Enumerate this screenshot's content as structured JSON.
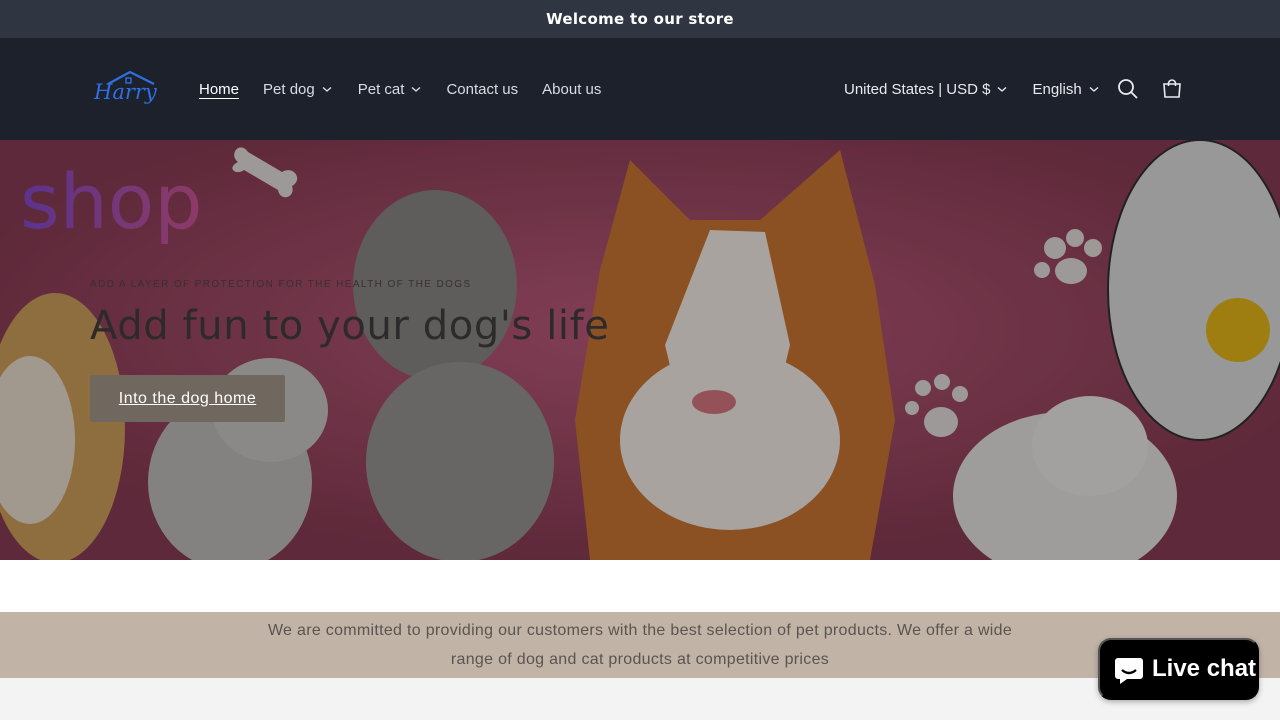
{
  "announcement": "Welcome to our store",
  "logo": {
    "text": "Harry"
  },
  "nav": {
    "items": [
      {
        "label": "Home",
        "active": true
      },
      {
        "label": "Pet dog",
        "has_dropdown": true
      },
      {
        "label": "Pet cat",
        "has_dropdown": true
      },
      {
        "label": "Contact us"
      },
      {
        "label": "About us"
      }
    ]
  },
  "tools": {
    "country_currency": "United States | USD $",
    "language": "English",
    "icons": [
      "search-icon",
      "cart-icon"
    ]
  },
  "hero": {
    "background_text": "shop",
    "kicker": "ADD A LAYER OF PROTECTION FOR THE HEALTH OF THE DOGS",
    "title": "Add fun to your dog's life",
    "button_label": "Into the dog home"
  },
  "commitment": {
    "line1": "We are committed to providing our customers with the best selection of pet products. We offer a wide",
    "line2": "range of dog and cat products at competitive prices"
  },
  "live_chat": {
    "label": "Live chat"
  },
  "colors": {
    "announcement_bg": "#2f3541",
    "header_bg": "#1c212b",
    "hero_bg": "#a7536c",
    "button_bg": "#70675e",
    "commitment_bg": "#c1b4a7",
    "logo_blue": "#2f6fe0"
  }
}
